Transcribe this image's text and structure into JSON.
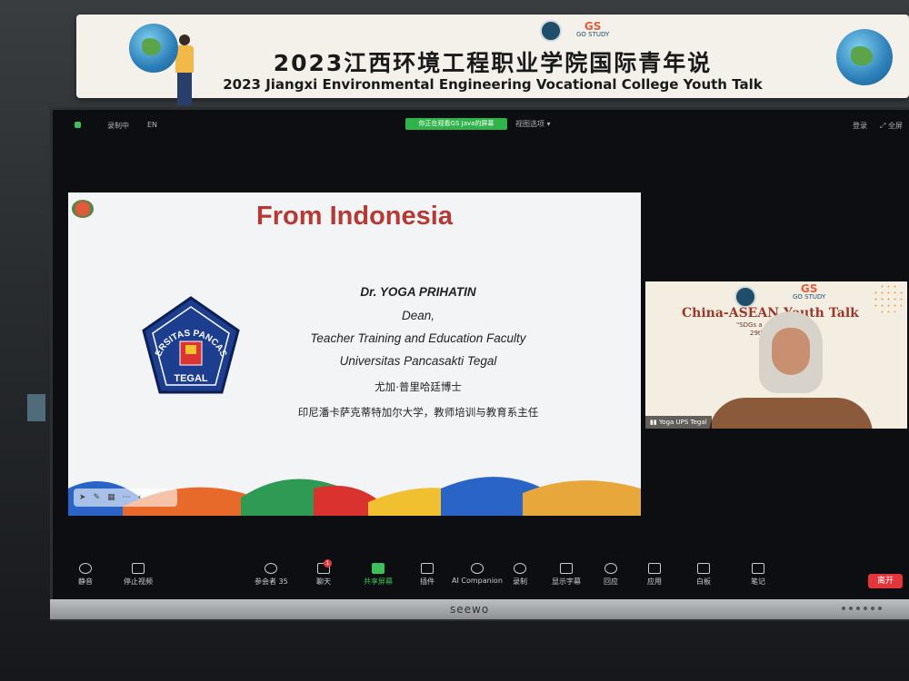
{
  "banner": {
    "title_cn": "2023江西环境工程职业学院国际青年说",
    "title_en": "2023 Jiangxi Environmental Engineering Vocational College Youth Talk",
    "gs_logo_letters": "GS",
    "gs_logo_text": "GO STUDY"
  },
  "zoom_topbar": {
    "recording": "录制中",
    "language": "EN",
    "sharing_notice": "你正在观看GS Java的屏幕",
    "view_options": "视图选项",
    "exit": "登录",
    "fullscreen": "全屏"
  },
  "slide": {
    "title": "From Indonesia",
    "speaker_name": "Dr. YOGA PRIHATIN",
    "role": "Dean,",
    "faculty": "Teacher Training and Education Faculty",
    "university": "Universitas Pancasakti Tegal",
    "name_cn": "尤加·普里哈廷博士",
    "role_cn": "印尼潘卡萨克蒂特加尔大学，教师培训与教育系主任",
    "logo_top_text": "UNIVERSITAS PANCASAKTI",
    "logo_bottom_text": "TEGAL"
  },
  "video_tile": {
    "banner_title": "China-ASEAN Youth Talk",
    "banner_sub1": "\"SDGs a",
    "banner_sub2": "29th N",
    "gs_letters": "GS",
    "gs_text": "GO STUDY",
    "participant_name": "Yoga UPS Tegal"
  },
  "toolbar": {
    "items": [
      {
        "label": "静音"
      },
      {
        "label": "停止视频"
      },
      {
        "label": "参会者",
        "count": "35"
      },
      {
        "label": "聊天",
        "badge": "1"
      },
      {
        "label": "共享屏幕"
      },
      {
        "label": "插件"
      },
      {
        "label": "AI Companion"
      },
      {
        "label": "录制"
      },
      {
        "label": "显示字幕"
      },
      {
        "label": "回应"
      },
      {
        "label": "应用"
      },
      {
        "label": "白板"
      },
      {
        "label": "笔记"
      }
    ],
    "leave": "离开"
  },
  "monitor": {
    "brand": "seewo"
  }
}
